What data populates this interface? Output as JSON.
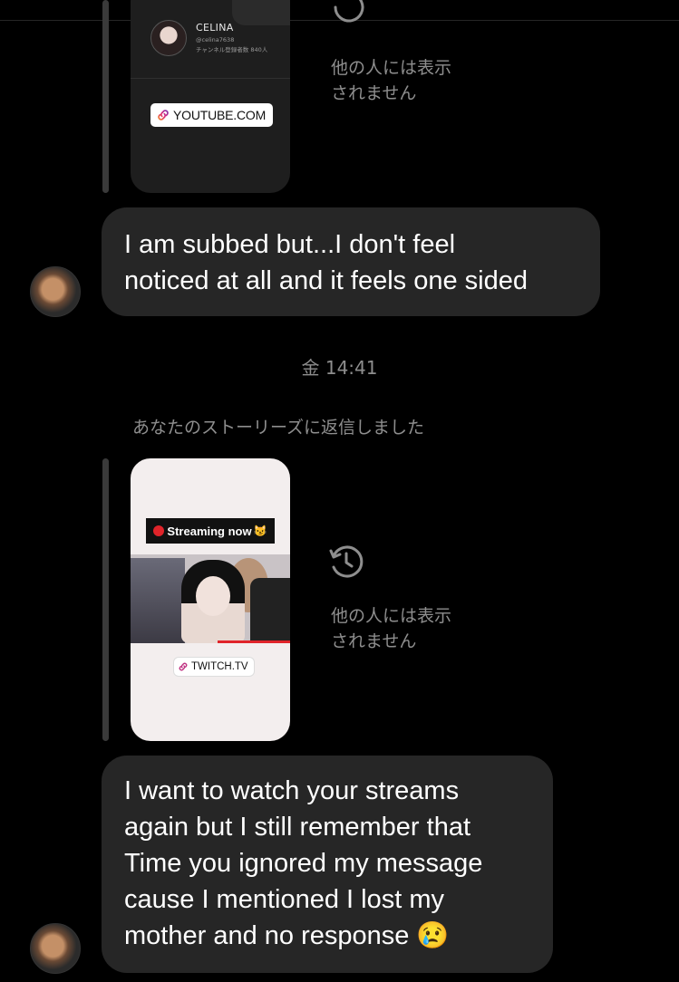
{
  "colors": {
    "background": "#000000",
    "bubble": "#262626",
    "muted_text": "#8e8e8e",
    "reply_bar": "#3a3a3a"
  },
  "story_1": {
    "channel_name": "CELINA",
    "channel_handle": "@celina7638",
    "subscriber_text": "チャンネル登録者数 840人",
    "link_label": "YOUTUBE.COM",
    "link_icon": "link-icon",
    "status_icon": "history-icon",
    "hidden_note_line1": "他の人には表示",
    "hidden_note_line2": "されません"
  },
  "messages": [
    {
      "line1": "I am subbed but...I don't feel",
      "line2": "noticed at all and it feels one sided"
    },
    {
      "line1": "I want to watch your streams",
      "line2": "again but I still remember that",
      "line3": "Time you ignored my message",
      "line4": "cause I mentioned I lost my",
      "line5": "mother and no response 😢"
    }
  ],
  "timestamp": "金 14:41",
  "reply_label": "あなたのストーリーズに返信しました",
  "story_2": {
    "banner": "Streaming now",
    "banner_emoji": "😼",
    "link_label": "TWITCH.TV",
    "link_icon": "link-icon",
    "status_icon": "history-icon",
    "hidden_note_line1": "他の人には表示",
    "hidden_note_line2": "されません"
  }
}
